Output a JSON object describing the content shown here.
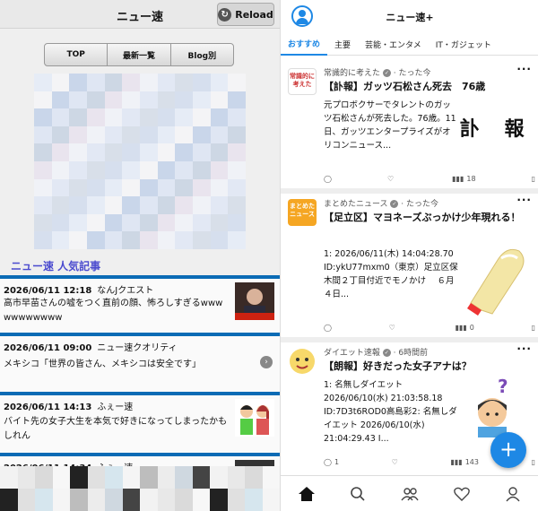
{
  "left": {
    "title": "ニュー速",
    "reload_label": "Reload",
    "nav": [
      "TOP",
      "最新一覧",
      "Blog別"
    ],
    "section_title": "ニュー速 人気記事",
    "articles": [
      {
        "date": "2026/06/11 12:18",
        "source": "なんJクエスト",
        "title": "高市早苗さんの嘘をつく直前の顔、怖ろしすぎるwww",
        "extra": "wwwwwwww"
      },
      {
        "date": "2026/06/11 09:00",
        "source": "ニュー速クオリティ",
        "title": "メキシコ「世界の皆さん、メキシコは安全です」"
      },
      {
        "date": "2026/06/11 14:13",
        "source": "ふぇー速",
        "title": "バイト先の女子大生を本気で好きになってしまったかもしれん"
      },
      {
        "date": "2026/06/11 14:34",
        "source": "ふぇー速",
        "title": ""
      }
    ]
  },
  "right": {
    "title": "ニュー速+",
    "tabs": [
      "おすすめ",
      "主要",
      "芸能・エンタメ",
      "IT・ガジェット"
    ],
    "cards": [
      {
        "source": "常識的に考えた",
        "time": "たった今",
        "logo": "常識的に考えた",
        "title": "【訃報】ガッツ石松さん死去　76歳",
        "body": "元プロボクサーでタレントのガッツ石松さんが死去した。76歳。11日、ガッツエンタープライズがオリコンニュース...",
        "image_text": "訃 報",
        "likes": "",
        "views": "18"
      },
      {
        "source": "まとめたニュース",
        "time": "たった今",
        "logo": "まとめたニュース",
        "title": "【足立区】マヨネーズぶっかけ少年現れる！",
        "body": "1: 2026/06/11(木) 14:04:28.70 ID:ykU77mxm0（東京）足立区保木間２丁目付近でモノかけ　 ６月４日...",
        "likes": "",
        "views": "0"
      },
      {
        "source": "ダイエット速報",
        "time": "6時間前",
        "logo": "",
        "title": "【朗報】好きだった女子アナは？",
        "body": "1: 名無しダイエット 2026/06/10(水) 21:03:58.18 ID:7D3t6ROD0高島彩2: 名無しダイエット 2026/06/10(水) 21:04:29.43 I...",
        "likes": "1",
        "views": "143"
      }
    ],
    "fab": "+"
  },
  "colors": {
    "accent": "#1e88e5",
    "section": "#4b4bcf",
    "left_bar": "#0b6bb5"
  }
}
